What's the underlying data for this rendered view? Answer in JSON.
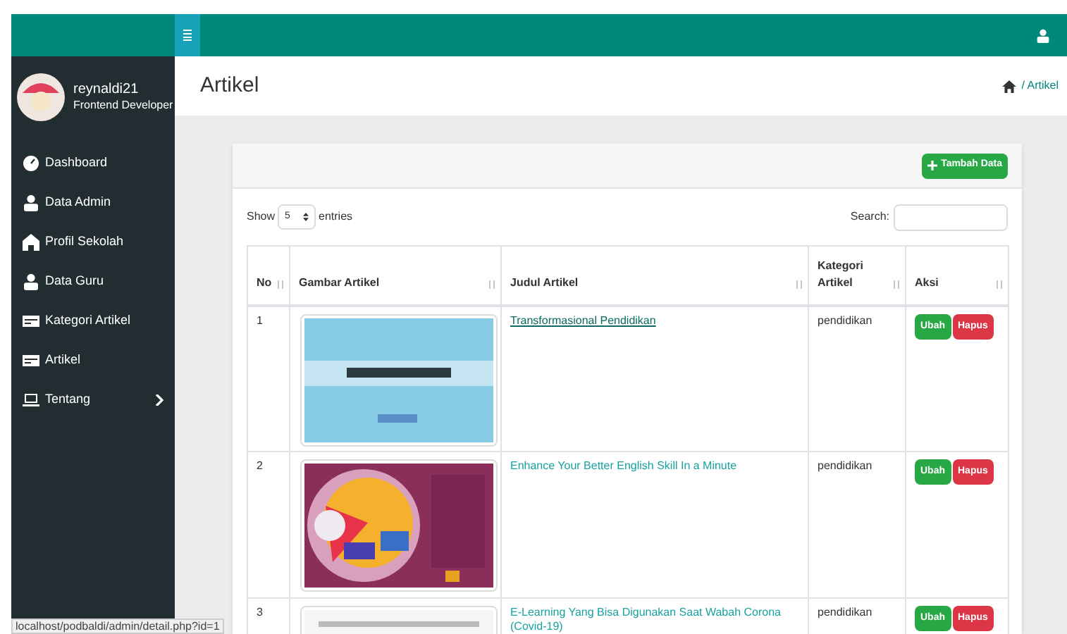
{
  "sidebar": {
    "user": {
      "name": "reynaldi21",
      "role": "Frontend Developer"
    },
    "items": [
      {
        "label": "Dashboard",
        "kind": "dashboard",
        "has_submenu": false
      },
      {
        "label": "Data Admin",
        "kind": "user",
        "has_submenu": false
      },
      {
        "label": "Profil Sekolah",
        "kind": "school",
        "has_submenu": false
      },
      {
        "label": "Data Guru",
        "kind": "user",
        "has_submenu": false
      },
      {
        "label": "Kategori Artikel",
        "kind": "card",
        "has_submenu": false
      },
      {
        "label": "Artikel",
        "kind": "card",
        "has_submenu": false
      },
      {
        "label": "Tentang",
        "kind": "laptop",
        "has_submenu": true
      }
    ]
  },
  "page": {
    "title": "Artikel",
    "breadcrumb": "/ Artikel"
  },
  "card": {
    "add_button": "Tambah Data",
    "show_label": "Show",
    "page_size": "5",
    "entries_label": "entries",
    "search_label": "Search:",
    "table": {
      "columns": [
        "No",
        "Gambar Artikel",
        "Judul Artikel",
        "Kategori Artikel",
        "Aksi"
      ],
      "rows": [
        {
          "no": "1",
          "title": "Transformasional Pendidikan",
          "hovered": true,
          "category": "pendidikan",
          "actions": [
            "Ubah",
            "Hapus"
          ]
        },
        {
          "no": "2",
          "title": "Enhance Your Better English Skill In a Minute",
          "hovered": false,
          "category": "pendidikan",
          "actions": [
            "Ubah",
            "Hapus"
          ]
        },
        {
          "no": "3",
          "title": "E-Learning Yang Bisa Digunakan Saat Wabah Corona (Covid-19)",
          "hovered": false,
          "category": "pendidikan",
          "actions": [
            "Ubah",
            "Hapus"
          ]
        }
      ]
    }
  },
  "status_bar": "localhost/podbaldi/admin/detail.php?id=1"
}
